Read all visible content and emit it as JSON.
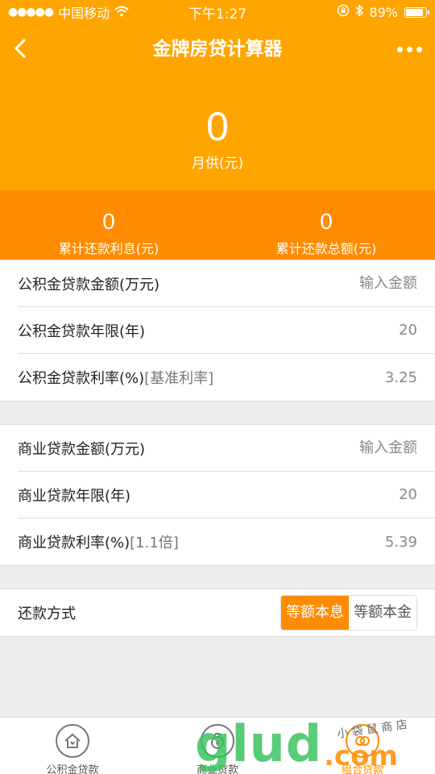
{
  "status_bar": {
    "signal": "●●●●●",
    "carrier": "中国移动",
    "time": "下午1:27",
    "battery": "89%",
    "battery_level": 0.89
  },
  "nav": {
    "title": "金牌房贷计算器"
  },
  "hero": {
    "value": "0",
    "label": "月供(元)"
  },
  "summary": {
    "interest_value": "0",
    "interest_label": "累计还款利息(元)",
    "total_value": "0",
    "total_label": "累计还款总额(元)"
  },
  "provident": {
    "amount_label": "公积金贷款金额(万元)",
    "amount_placeholder": "输入金额",
    "years_label": "公积金贷款年限(年)",
    "years_value": "20",
    "rate_label": "公积金贷款利率(%)",
    "rate_note": "[基准利率]",
    "rate_value": "3.25"
  },
  "commercial": {
    "amount_label": "商业贷款金额(万元)",
    "amount_placeholder": "输入金额",
    "years_label": "商业贷款年限(年)",
    "years_value": "20",
    "rate_label": "商业贷款利率(%)",
    "rate_note": "[1.1倍]",
    "rate_value": "5.39"
  },
  "repayment": {
    "label": "还款方式",
    "options": [
      "等额本息",
      "等额本金"
    ],
    "selected": "等额本息"
  },
  "tabs": [
    {
      "label": "公积金贷款",
      "icon": "house-icon"
    },
    {
      "label": "商业贷款",
      "icon": "money-bag-icon"
    },
    {
      "label": "组合贷款",
      "icon": "combo-icon"
    }
  ],
  "watermark": {
    "brand": "glud",
    "suffix": ".com",
    "script": "小 袋 鼠 商 店"
  },
  "colors": {
    "primary": "#ffa500",
    "accent": "#ff8c00"
  }
}
